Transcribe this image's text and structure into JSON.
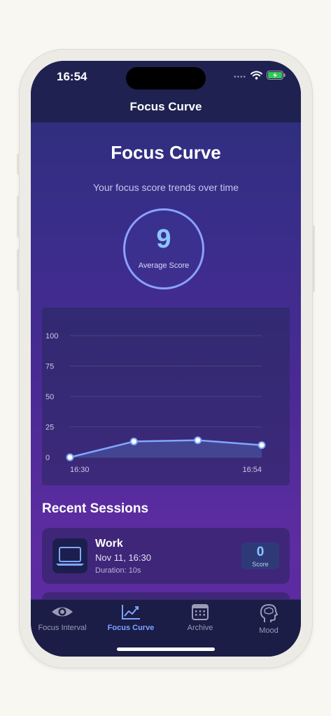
{
  "status": {
    "time": "16:54",
    "signal": "••••"
  },
  "nav": {
    "title": "Focus Curve"
  },
  "hero": {
    "title": "Focus Curve",
    "subtitle": "Your focus score trends over time",
    "score": "9",
    "score_label": "Average Score"
  },
  "chart_data": {
    "type": "area",
    "y_ticks": [
      "100",
      "75",
      "50",
      "25",
      "0"
    ],
    "x_labels": [
      "16:30",
      "16:54"
    ],
    "ylim": [
      0,
      100
    ],
    "grid": true,
    "values": [
      0,
      13,
      14,
      10
    ],
    "line_color": "#7fa7ff",
    "fill_color": "#4a5ca8"
  },
  "sessions": {
    "title": "Recent Sessions",
    "items": [
      {
        "name": "Work",
        "date": "Nov 11, 16:30",
        "duration": "Duration: 10s",
        "score": "0",
        "score_label": "Score",
        "icon": "laptop-icon"
      }
    ]
  },
  "tabs": [
    {
      "label": "Focus Interval",
      "icon": "eye-icon",
      "active": false
    },
    {
      "label": "Focus Curve",
      "icon": "chart-line-icon",
      "active": true
    },
    {
      "label": "Archive",
      "icon": "calendar-icon",
      "active": false
    },
    {
      "label": "Mood",
      "icon": "brain-head-icon",
      "active": false
    }
  ],
  "colors": {
    "accent": "#7fa3ff",
    "score": "#8cc4ff",
    "circle_border": "#8aa1ff"
  }
}
